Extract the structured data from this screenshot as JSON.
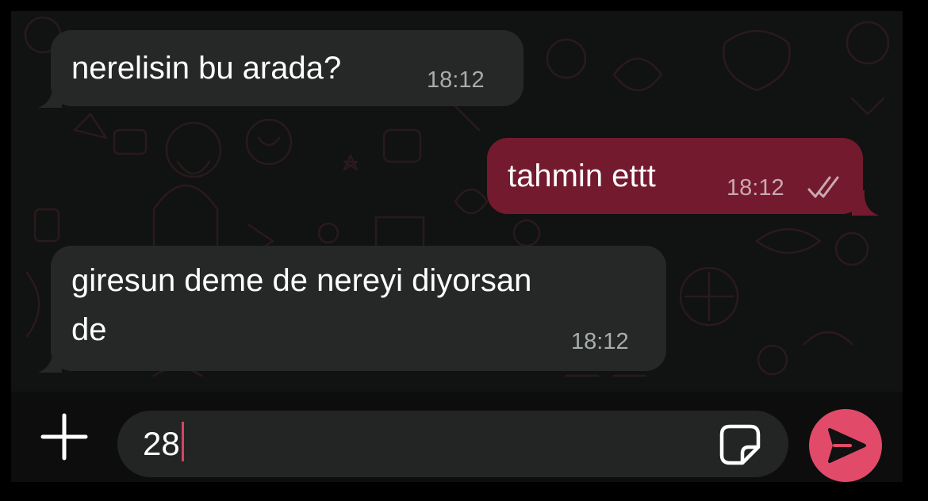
{
  "messages": [
    {
      "direction": "incoming",
      "lines": [
        "nerelisin bu arada?"
      ],
      "time": "18:12"
    },
    {
      "direction": "outgoing",
      "lines": [
        "tahmin ettt"
      ],
      "time": "18:12",
      "status_icon": "double-check-icon"
    },
    {
      "direction": "incoming",
      "lines": [
        "giresun deme de nereyi diyorsan",
        "de"
      ],
      "time": "18:12"
    }
  ],
  "composer": {
    "value": "28",
    "attach_icon": "plus-icon",
    "sticker_icon": "sticker-icon",
    "send_icon": "send-icon"
  },
  "colors": {
    "incoming_bubble": "#252827",
    "outgoing_bubble": "#741a2e",
    "send_button": "#e24a6a",
    "caret": "#d14563"
  }
}
